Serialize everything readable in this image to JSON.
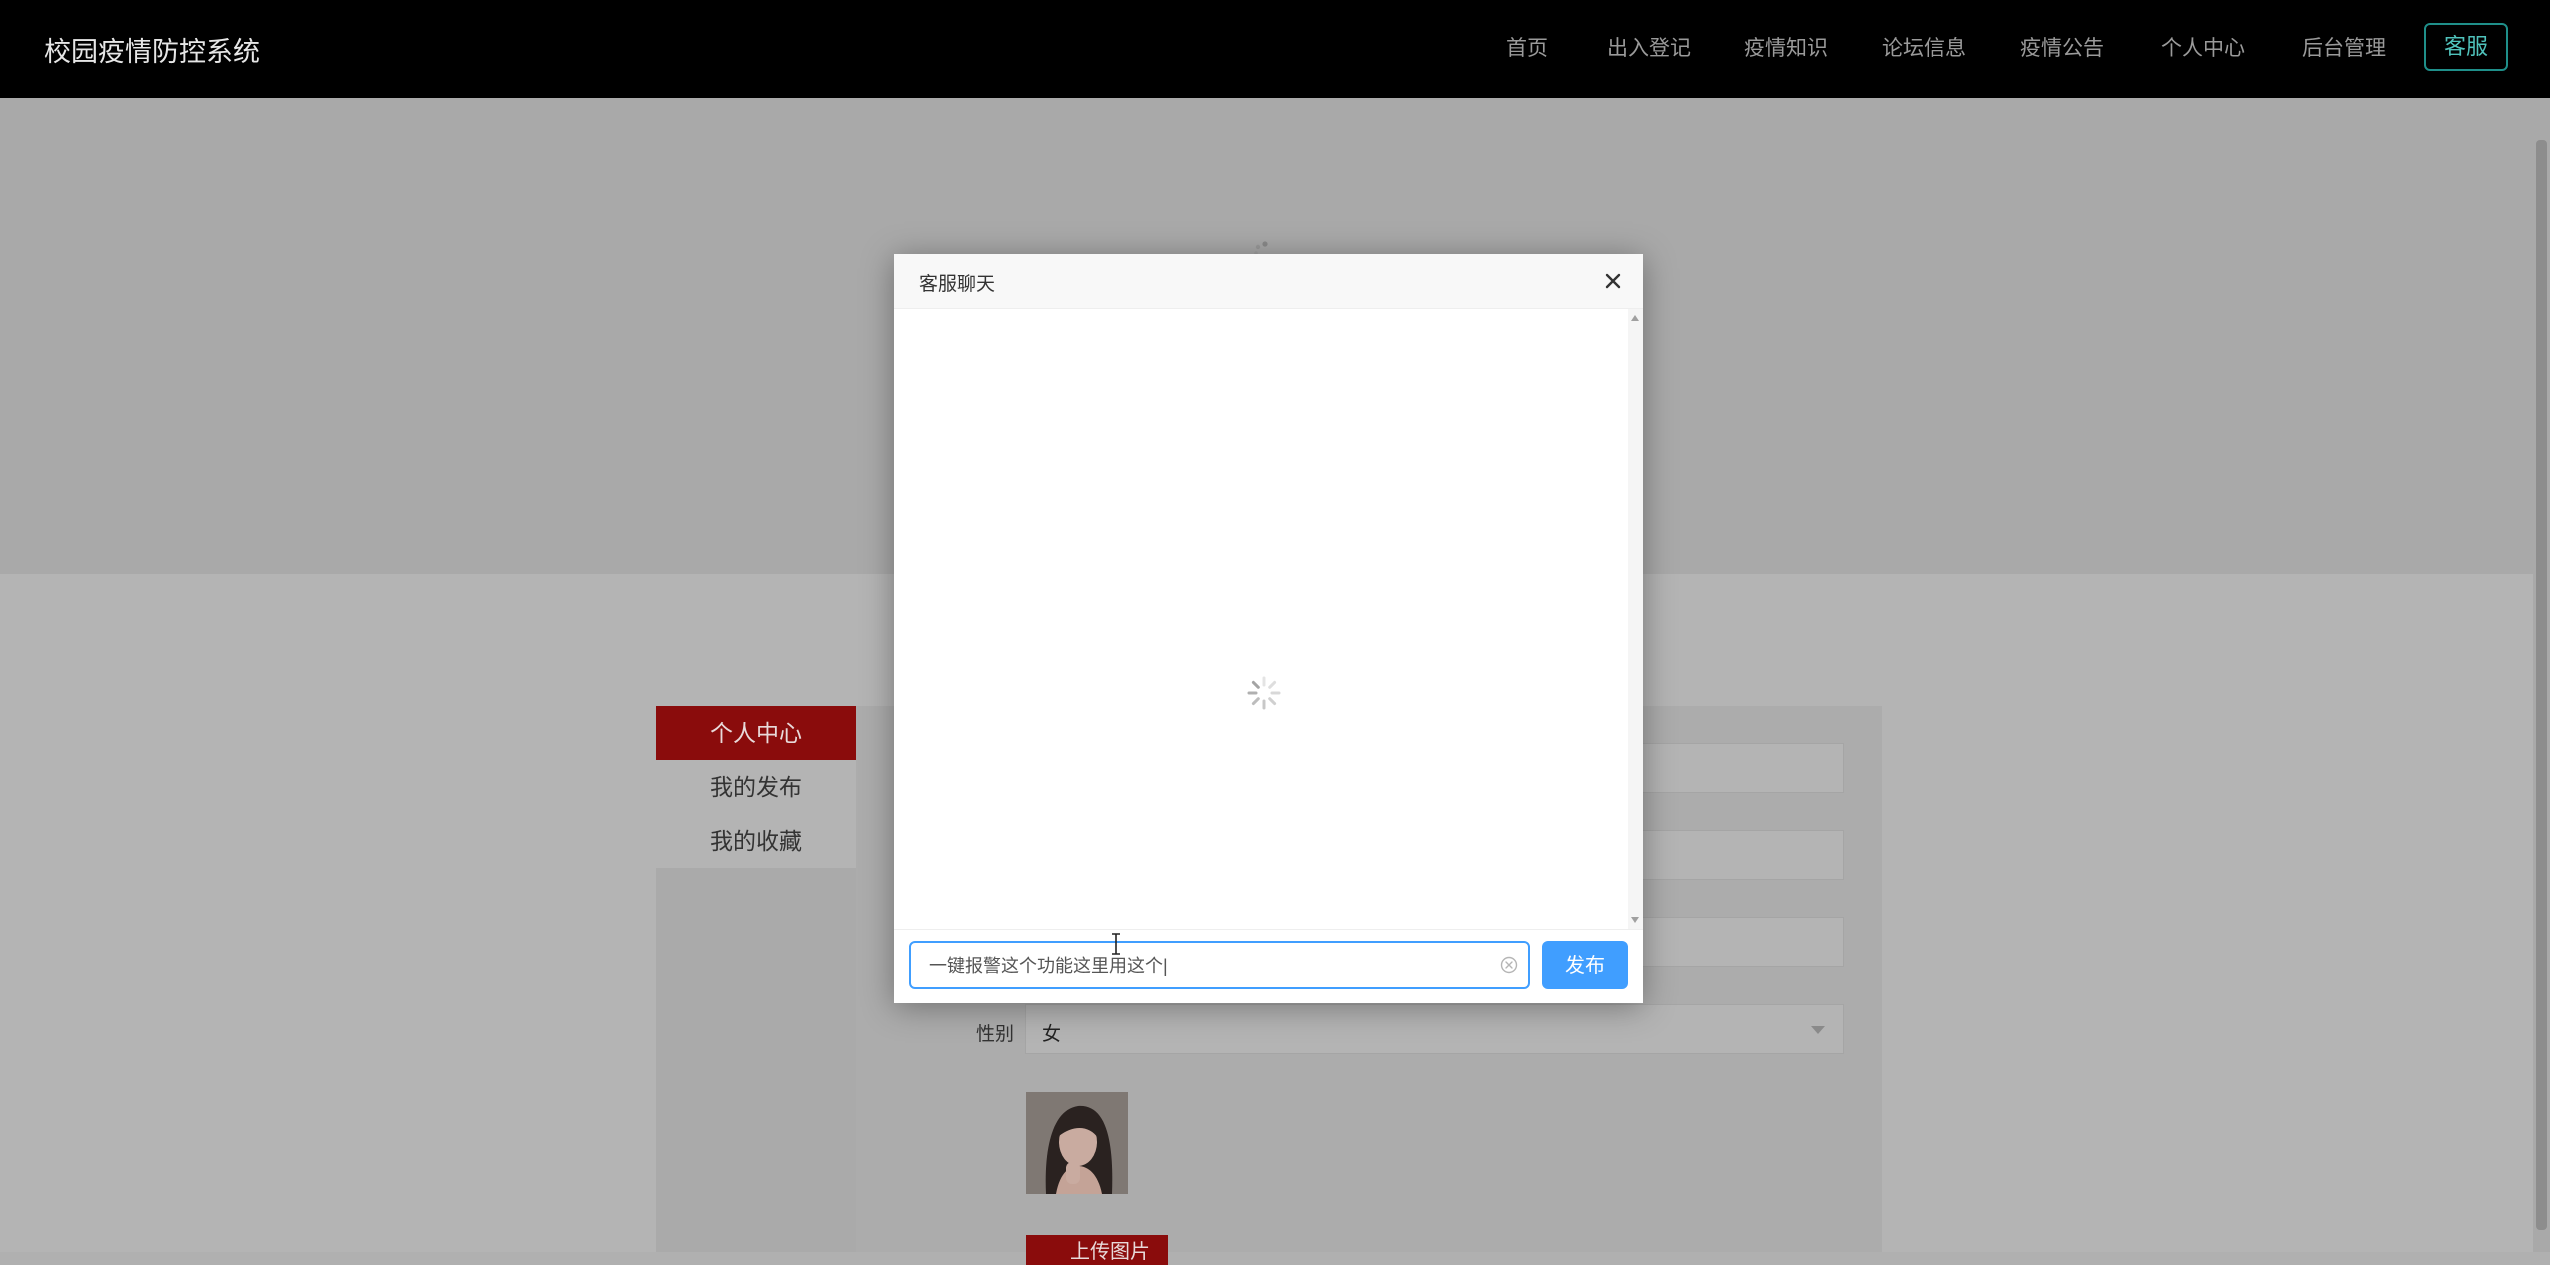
{
  "header": {
    "brand": "校园疫情防控系统",
    "nav": [
      {
        "label": "首页"
      },
      {
        "label": "出入登记"
      },
      {
        "label": "疫情知识"
      },
      {
        "label": "论坛信息"
      },
      {
        "label": "疫情公告"
      },
      {
        "label": "个人中心"
      },
      {
        "label": "后台管理"
      }
    ],
    "kefu_label": "客服"
  },
  "sidebar": {
    "items": [
      {
        "label": "个人中心",
        "active": true
      },
      {
        "label": "我的发布",
        "active": false
      },
      {
        "label": "我的收藏",
        "active": false
      }
    ]
  },
  "profile": {
    "gender_label": "性别",
    "gender_value": "女",
    "upload_label": "上传图片"
  },
  "modal": {
    "title": "客服聊天",
    "input_value": "一键报警这个功能这里用这个|",
    "publish_label": "发布"
  },
  "icons": {
    "close": "close-icon",
    "clear": "circle-close-icon",
    "loading": "loading-spinner-icon"
  },
  "colors": {
    "topbar": "#000000",
    "accent_red": "#8a0c0c",
    "primary_blue": "#409eff",
    "kefu_teal": "#1f8f8a"
  }
}
